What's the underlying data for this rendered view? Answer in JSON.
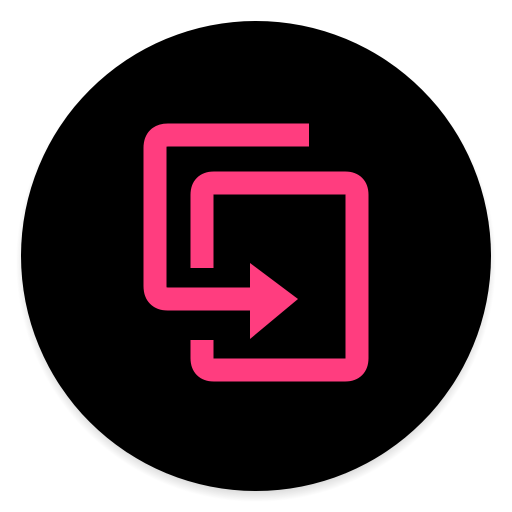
{
  "icon": {
    "name": "move-to-folder-icon",
    "background_color": "#000000",
    "foreground_color": "#ff3d7f",
    "shadow_color": "#bdbdbd"
  }
}
